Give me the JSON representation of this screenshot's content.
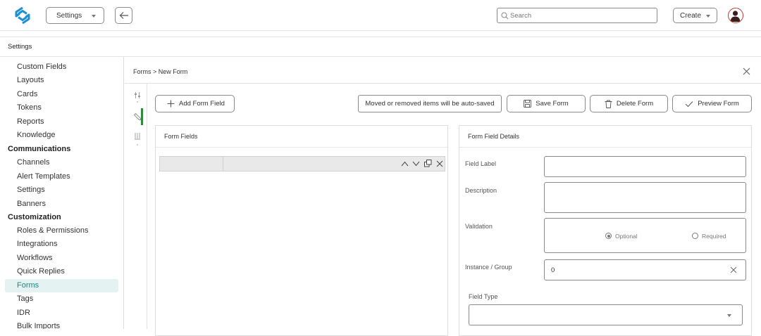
{
  "header": {
    "logo": "app-logo",
    "workspace_select": "Settings",
    "back_icon": "arrow-left-icon",
    "search_placeholder": "Search",
    "create_label": "Create",
    "avatar": "user-avatar-icon"
  },
  "page_title": "Settings",
  "sidebar": {
    "items": [
      {
        "label": "Custom Fields",
        "type": "item"
      },
      {
        "label": "Layouts",
        "type": "item"
      },
      {
        "label": "Cards",
        "type": "item"
      },
      {
        "label": "Tokens",
        "type": "item"
      },
      {
        "label": "Reports",
        "type": "item"
      },
      {
        "label": "Knowledge",
        "type": "item"
      },
      {
        "label": "Communications",
        "type": "section"
      },
      {
        "label": "Channels",
        "type": "item"
      },
      {
        "label": "Alert Templates",
        "type": "item"
      },
      {
        "label": "Settings",
        "type": "item"
      },
      {
        "label": "Banners",
        "type": "item"
      },
      {
        "label": "Customization",
        "type": "section"
      },
      {
        "label": "Roles & Permissions",
        "type": "item"
      },
      {
        "label": "Integrations",
        "type": "item"
      },
      {
        "label": "Workflows",
        "type": "item"
      },
      {
        "label": "Quick Replies",
        "type": "item"
      },
      {
        "label": "Forms",
        "type": "item",
        "active": true
      },
      {
        "label": "Tags",
        "type": "item"
      },
      {
        "label": "IDR",
        "type": "item"
      },
      {
        "label": "Bulk Imports",
        "type": "item"
      }
    ],
    "active_color": "#1a8a7d"
  },
  "main": {
    "breadcrumb": "Forms > New Form",
    "toolbar": {
      "add_field": "Add Form Field",
      "autosave_note": "Moved or removed items will be auto-saved",
      "save": "Save Form",
      "delete": "Delete Form",
      "preview": "Preview Form"
    },
    "form_fields_panel": {
      "title": "Form Fields"
    },
    "details_panel": {
      "title": "Form Field Details",
      "field_label": "Field Label",
      "field_label_value": "",
      "description": "Description",
      "description_value": "",
      "validation": "Validation",
      "validation_options": [
        "Optional",
        "Required"
      ],
      "validation_selected": "Optional",
      "instance_group": "Instance / Group",
      "instance_group_value": "0",
      "field_type": "Field Type",
      "field_type_value": ""
    },
    "rail_active_color": "#2e8b3a"
  }
}
